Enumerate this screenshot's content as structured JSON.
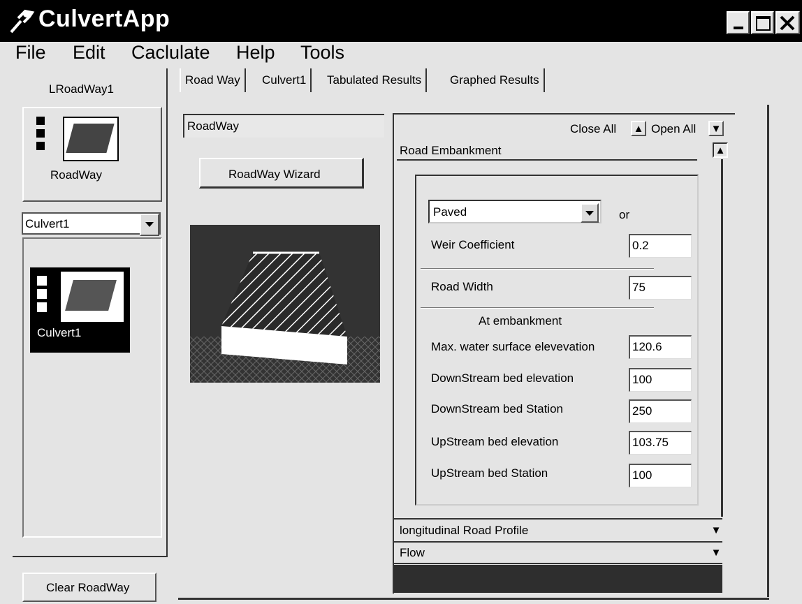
{
  "window": {
    "title": "CulvertApp",
    "controls": [
      "_",
      "□",
      "✕"
    ]
  },
  "menu": {
    "file": "File",
    "edit": "Edit",
    "calculate": "Caclulate",
    "help": "Help",
    "tools": "Tools"
  },
  "left_panel": {
    "header": "LRoadWay1",
    "roadway_item": "RoadWay",
    "culvert_select": "Culvert1",
    "culvert_item": "Culvert1",
    "clear_button": "Clear RoadWay"
  },
  "tabs": [
    "Road Way",
    "Culvert1",
    "Tabulated Results",
    "Graphed Results"
  ],
  "roadway_name_field": "RoadWay",
  "wizard_button": "RoadWay Wizard",
  "right_panel": {
    "close_all": "Close All",
    "open_all": "Open All",
    "section_road_embankment": "Road Embankment",
    "surface_select": "Paved",
    "or_label": "or",
    "weir_label": "Weir Coefficient",
    "weir_value": "0.2",
    "road_width_label": "Road Width",
    "road_width_value": "75",
    "at_embankment": "At embankment",
    "max_ws_label": "Max. water surface elevevation",
    "max_ws_value": "120.6",
    "ds_elev_label": "DownStream bed elevation",
    "ds_elev_value": "100",
    "ds_station_label": "DownStream bed Station",
    "ds_station_value": "250",
    "us_elev_label": "UpStream bed elevation",
    "us_elev_value": "103.75",
    "us_station_label": "UpStream bed Station",
    "us_station_value": "100",
    "section_longitudinal": "longitudinal Road Profile",
    "section_flow": "Flow"
  }
}
